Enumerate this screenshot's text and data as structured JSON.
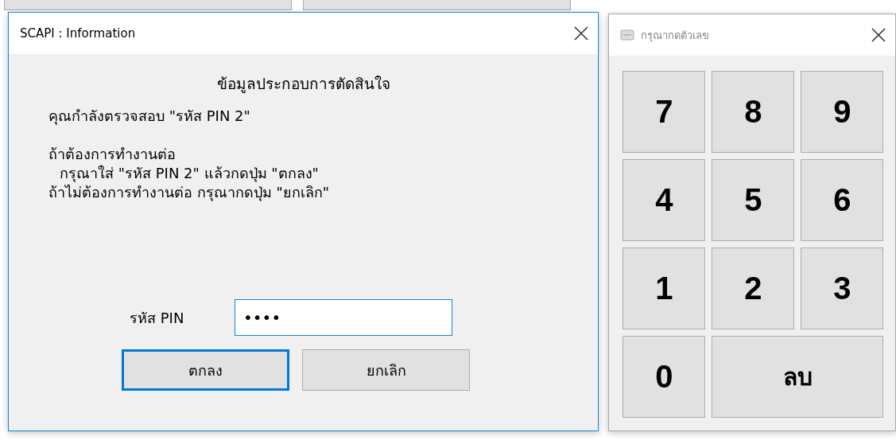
{
  "info_dialog": {
    "title": "SCAPI : Information",
    "heading": "ข้อมูลประกอบการตัดสินใจ",
    "lines": [
      {
        "text": "คุณกำลังตรวจสอบ \"รหัส PIN 2\"",
        "indent": false
      },
      {
        "text": "ถ้าต้องการทำงานต่อ",
        "indent": false
      },
      {
        "text": "กรุณาใส่ \"รหัส PIN 2\" แล้วกดปุ่ม \"ตกลง\"",
        "indent": true
      },
      {
        "text": "ถ้าไม่ต้องการทำงานต่อ กรุณากดปุ่ม \"ยกเลิก\"",
        "indent": false
      }
    ],
    "pin_label": "รหัส PIN",
    "pin_field": {
      "value": "••••"
    },
    "buttons": [
      {
        "label": "ตกลง",
        "default": true
      },
      {
        "label": "ยกเลิก",
        "default": false
      }
    ]
  },
  "keypad_dialog": {
    "title": "กรุณากดตัวเลข",
    "keys": [
      {
        "label": "7",
        "kind": "digit"
      },
      {
        "label": "8",
        "kind": "digit"
      },
      {
        "label": "9",
        "kind": "digit"
      },
      {
        "label": "4",
        "kind": "digit"
      },
      {
        "label": "5",
        "kind": "digit"
      },
      {
        "label": "6",
        "kind": "digit"
      },
      {
        "label": "1",
        "kind": "digit"
      },
      {
        "label": "2",
        "kind": "digit"
      },
      {
        "label": "3",
        "kind": "digit"
      },
      {
        "label": "0",
        "kind": "digit"
      },
      {
        "label": "ลบ",
        "kind": "wide"
      }
    ]
  }
}
